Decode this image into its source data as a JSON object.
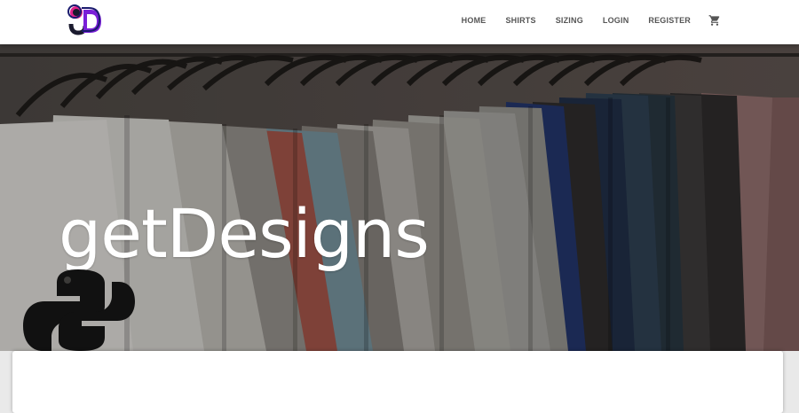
{
  "nav": {
    "logo_icon": "gd-logo-icon",
    "items": [
      {
        "label": "HOME"
      },
      {
        "label": "SHIRTS"
      },
      {
        "label": "SIZING"
      },
      {
        "label": "LOGIN"
      },
      {
        "label": "REGISTER"
      }
    ],
    "cart_icon": "shopping-cart-icon"
  },
  "hero": {
    "title": "getDesigns",
    "watermark_icon": "python-logo-icon"
  },
  "colors": {
    "nav_text": "#555555",
    "hero_overlay": "#3b3a38",
    "logo_primary": "#1a1a6e",
    "logo_accent": "#e0218a"
  }
}
